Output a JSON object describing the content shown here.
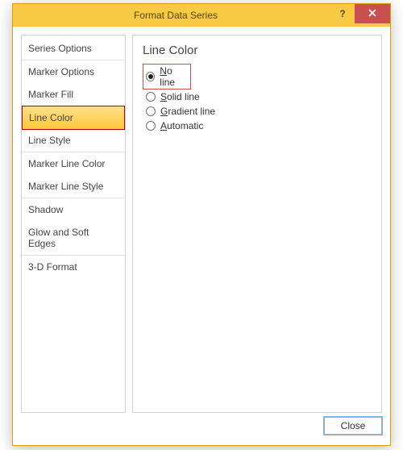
{
  "dialog": {
    "title": "Format Data Series",
    "help_label": "?",
    "close_label": "✕"
  },
  "sidebar": {
    "items": [
      {
        "label": "Series Options"
      },
      {
        "label": "Marker Options"
      },
      {
        "label": "Marker Fill"
      },
      {
        "label": "Line Color",
        "selected": true
      },
      {
        "label": "Line Style"
      },
      {
        "label": "Marker Line Color"
      },
      {
        "label": "Marker Line Style"
      },
      {
        "label": "Shadow"
      },
      {
        "label": "Glow and Soft Edges"
      },
      {
        "label": "3-D Format"
      }
    ]
  },
  "pane": {
    "heading": "Line Color",
    "options": {
      "no_line": "No line",
      "solid_line": "Solid line",
      "gradient_line": "Gradient line",
      "automatic": "Automatic"
    },
    "selected": "no_line"
  },
  "footer": {
    "close_label": "Close"
  }
}
